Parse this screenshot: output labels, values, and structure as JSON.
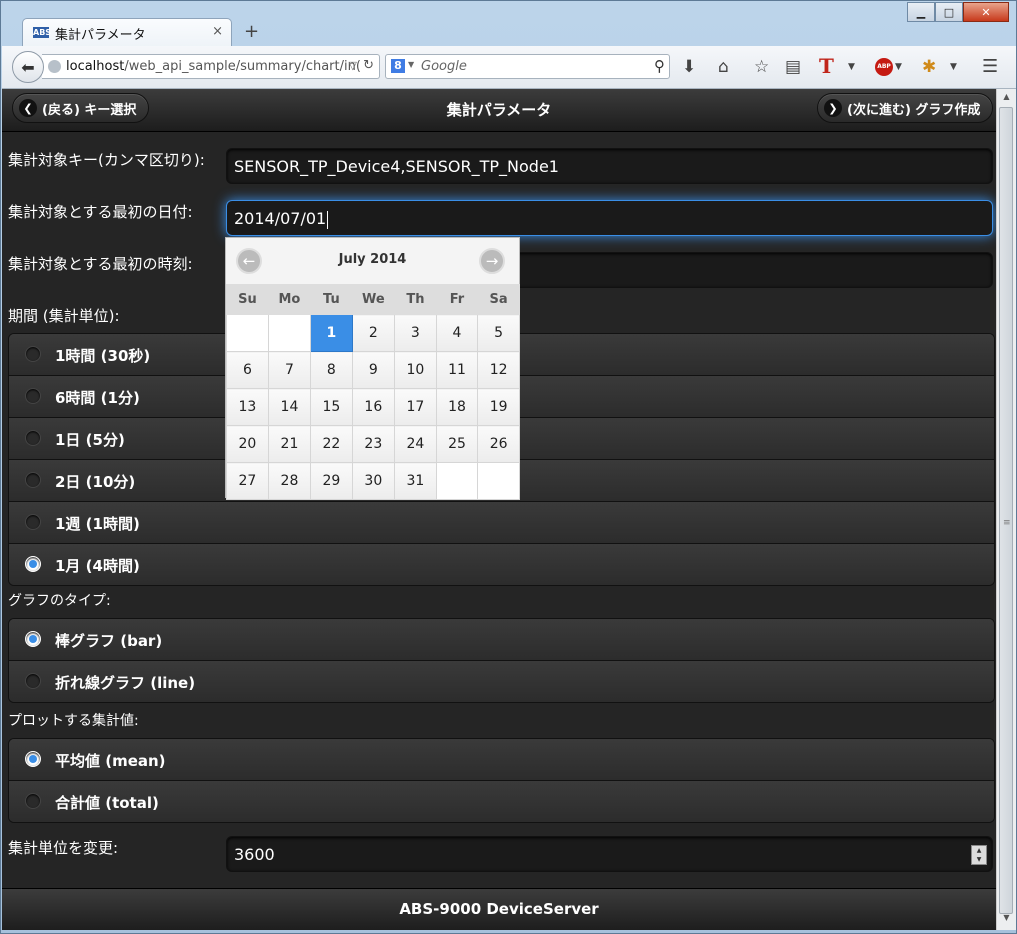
{
  "browser": {
    "tab_title": "集計パラメータ",
    "tab_favicon": "ABS",
    "tab_close": "×",
    "new_tab": "+",
    "url_host": "localhost",
    "url_path": "/web_api_sample/summary/chart/in(",
    "search_placeholder": "Google",
    "search_engine_badge": "8"
  },
  "header": {
    "back_label": "(戻る) キー選択",
    "title": "集計パラメータ",
    "next_label": "(次に進む) グラフ作成"
  },
  "form": {
    "keys_label": "集計対象キー(カンマ区切り):",
    "keys_value": "SENSOR_TP_Device4,SENSOR_TP_Node1",
    "start_date_label": "集計対象とする最初の日付:",
    "start_date_value": "2014/07/01",
    "start_time_label": "集計対象とする最初の時刻:",
    "period_label": "期間 (集計単位):",
    "periods": [
      {
        "label": "1時間 (30秒)",
        "selected": false
      },
      {
        "label": "6時間 (1分)",
        "selected": false
      },
      {
        "label": "1日 (5分)",
        "selected": false
      },
      {
        "label": "2日 (10分)",
        "selected": false
      },
      {
        "label": "1週 (1時間)",
        "selected": false
      },
      {
        "label": "1月 (4時間)",
        "selected": true
      }
    ],
    "graph_type_label": "グラフのタイプ:",
    "graph_types": [
      {
        "label": "棒グラフ (bar)",
        "selected": true
      },
      {
        "label": "折れ線グラフ (line)",
        "selected": false
      }
    ],
    "plot_value_label": "プロットする集計値:",
    "plot_values": [
      {
        "label": "平均値 (mean)",
        "selected": true
      },
      {
        "label": "合計値 (total)",
        "selected": false
      }
    ],
    "unit_label": "集計単位を変更:",
    "unit_value": "3600"
  },
  "calendar": {
    "month_label": "July 2014",
    "weekdays": [
      "Su",
      "Mo",
      "Tu",
      "We",
      "Th",
      "Fr",
      "Sa"
    ],
    "weeks": [
      [
        "",
        "",
        "1",
        "2",
        "3",
        "4",
        "5"
      ],
      [
        "6",
        "7",
        "8",
        "9",
        "10",
        "11",
        "12"
      ],
      [
        "13",
        "14",
        "15",
        "16",
        "17",
        "18",
        "19"
      ],
      [
        "20",
        "21",
        "22",
        "23",
        "24",
        "25",
        "26"
      ],
      [
        "27",
        "28",
        "29",
        "30",
        "31",
        "",
        ""
      ]
    ],
    "selected_day": "1"
  },
  "footer": {
    "text": "ABS-9000 DeviceServer"
  },
  "colors": {
    "accent": "#3a8ee6",
    "page_bg": "#252525"
  }
}
